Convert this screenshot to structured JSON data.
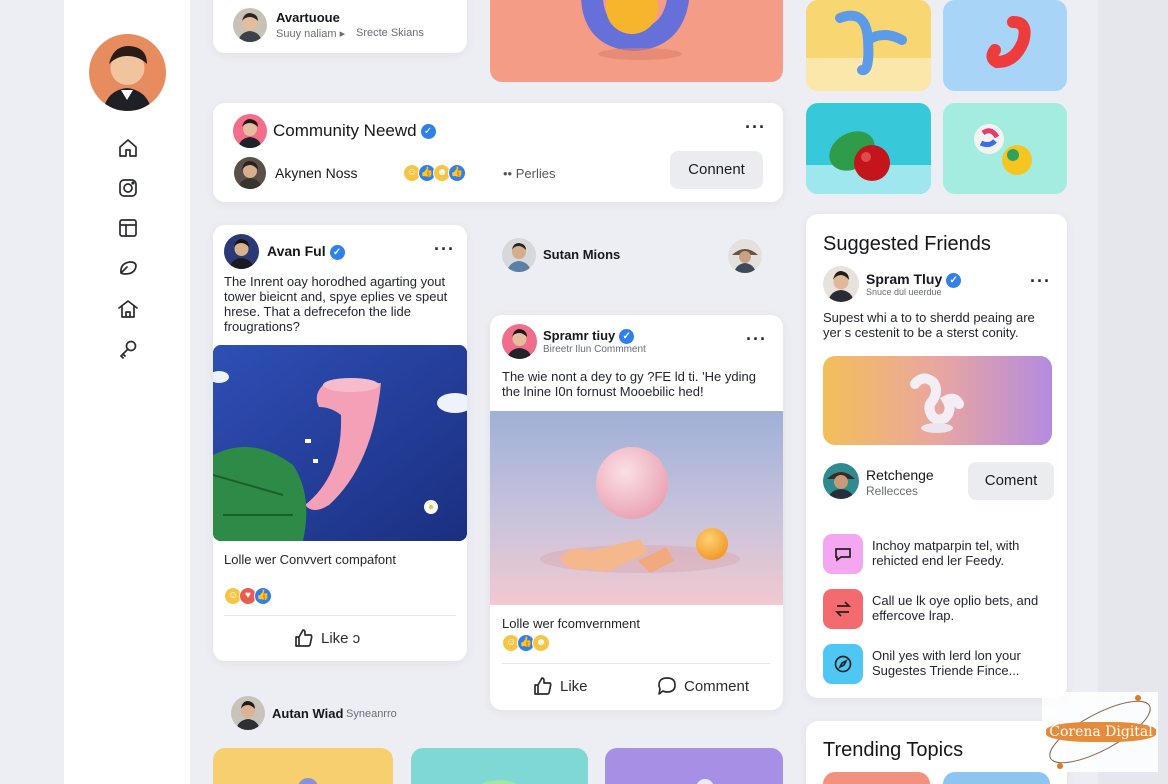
{
  "colors": {
    "accent": "#2f80ed",
    "background": "#eceef3",
    "card": "#ffffff"
  },
  "sidebar": {
    "nav": [
      {
        "icon": "home-icon"
      },
      {
        "icon": "instagram-icon"
      },
      {
        "icon": "browser-window-icon"
      },
      {
        "icon": "leaf-icon"
      },
      {
        "icon": "house-icon"
      },
      {
        "icon": "key-icon"
      }
    ]
  },
  "top_story": {
    "name": "Avartuoue",
    "meta": "Suuy naliam ▸",
    "meta2": "Srecte Skians"
  },
  "community": {
    "title": "Community Neewd",
    "member": "Akynen Noss",
    "peers": "•• Perlies",
    "button": "Connent"
  },
  "post1": {
    "author": "Avan Ful",
    "text": "The Inrent oay horodhed agarting yout tower bieicnt and, spye eplies ve speut hrese. That a defrecefon the lide frougrations?",
    "caption": "Lolle wer Convvert compafont",
    "like": "Like ɔ"
  },
  "story_user": {
    "name": "Sutan Mions"
  },
  "post2": {
    "author": "Spramr tiuy",
    "meta": "Bireetr Ilun Commment",
    "text": "The wie nont a dey to gy ?FE ld ti. 'He yding the lnine I0n fornust Mooebilic hed!",
    "caption": "Lolle wer fcomvernment",
    "like": "Like",
    "comment": "Comment"
  },
  "bottom_user": {
    "name": "Autan Wiad",
    "meta": "Syneanrro"
  },
  "suggested": {
    "heading": "Suggested Friends",
    "friend_name": "Spram Tluy",
    "friend_meta": "Snuce dul ueerdue",
    "text": "Supest whi a to to sherdd peaing are yer s cestenit to be a sterst conity.",
    "second_name": "Retchenge",
    "second_meta": "Rellecces",
    "button": "Coment"
  },
  "tips": [
    {
      "icon": "chat-icon",
      "color": "#f4a6f0",
      "text": "Inchoy matparpin tel, with rehicted end ler Feedy."
    },
    {
      "icon": "swap-icon",
      "color": "#f36a6f",
      "text": "Call ue lk oye oplio bets, and effercove lrap."
    },
    {
      "icon": "compass-icon",
      "color": "#4fc7f5",
      "text": "Onil yes with lerd lon your Sugestes Triende Fince..."
    }
  ],
  "trending": {
    "heading": "Trending Topics"
  },
  "watermark": "Corena Digital"
}
